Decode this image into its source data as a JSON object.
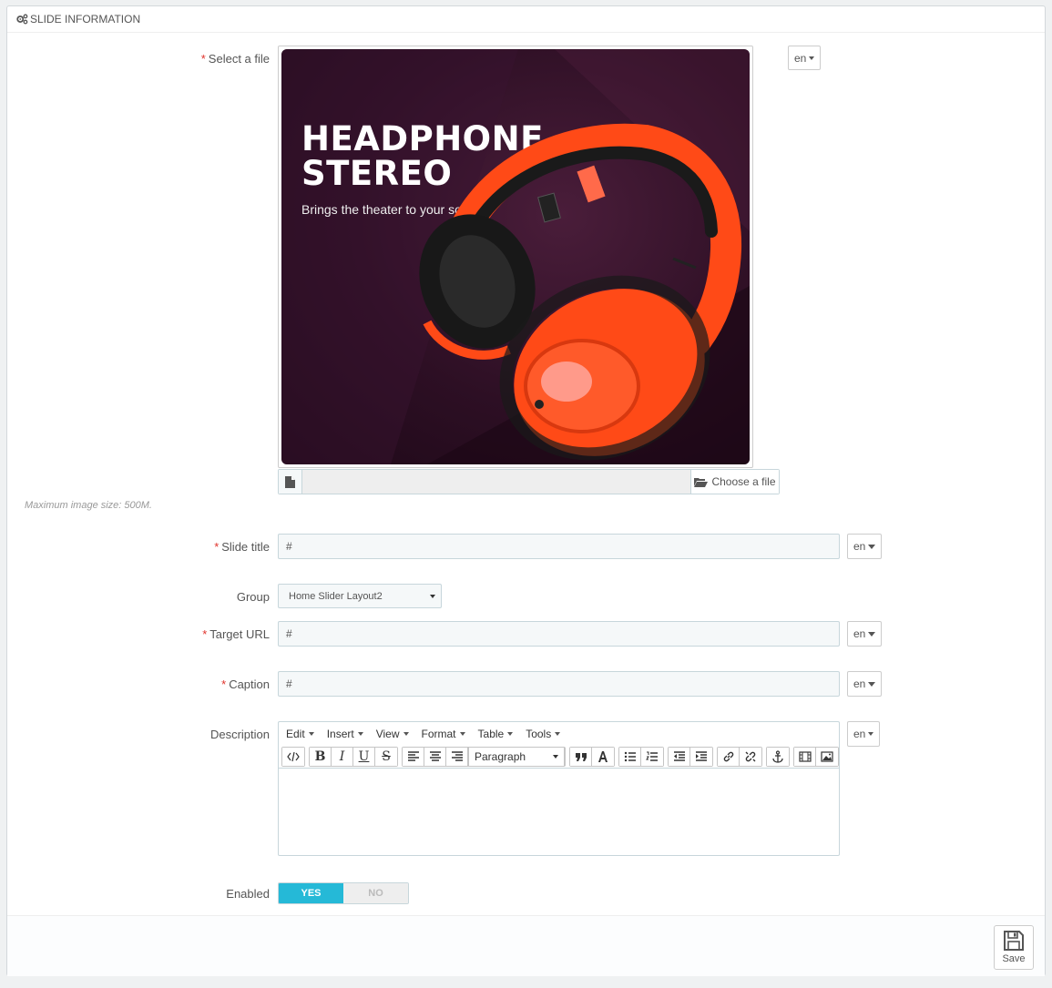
{
  "panel": {
    "title": "SLIDE INFORMATION"
  },
  "labels": {
    "select_file": "Select a file",
    "slide_title": "Slide title",
    "group": "Group",
    "target_url": "Target URL",
    "caption": "Caption",
    "description": "Description",
    "enabled": "Enabled"
  },
  "required_mark": "*",
  "lang": "en",
  "image": {
    "headline_line1": "HEADPHONE",
    "headline_line2": "STEREO",
    "tagline": "Brings the theater to your soul."
  },
  "file_input": {
    "choose_label": "Choose a file",
    "hint": "Maximum image size: 500M."
  },
  "fields": {
    "slide_title_value": "#",
    "group_value": "Home Slider Layout2",
    "target_url_value": "#",
    "caption_value": "#"
  },
  "editor": {
    "menu": [
      "Edit",
      "Insert",
      "View",
      "Format",
      "Table",
      "Tools"
    ],
    "format_select": "Paragraph",
    "bold": "B",
    "italic": "I",
    "underline": "U",
    "strike": "S"
  },
  "toggle": {
    "yes": "YES",
    "no": "NO",
    "value": "YES"
  },
  "footer": {
    "save_label": "Save"
  },
  "colors": {
    "accent": "#25b9d7",
    "required": "#e0322b",
    "headphone": "#ff4a17"
  }
}
